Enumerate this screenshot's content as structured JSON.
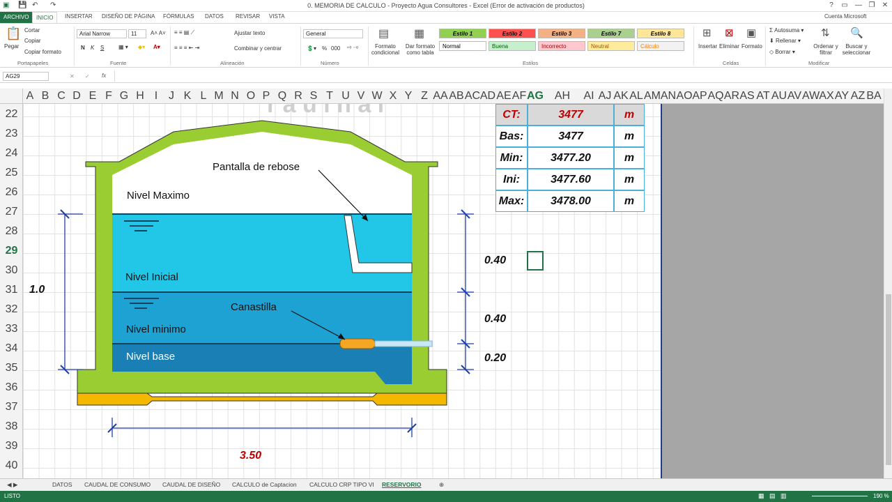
{
  "window": {
    "title": "0. MEMORIA DE CALCULO - Proyecto Agua Consultores - Excel (Error de activación de productos)",
    "account": "Cuenta Microsoft",
    "controls": [
      "?",
      "▭",
      "—",
      "❐",
      "✕"
    ]
  },
  "tabs": [
    "ARCHIVO",
    "INICIO",
    "INSERTAR",
    "DISEÑO DE PÁGINA",
    "FÓRMULAS",
    "DATOS",
    "REVISAR",
    "VISTA"
  ],
  "ribbon": {
    "paste": "Pegar",
    "cut": "Cortar",
    "copy": "Copiar",
    "copy_format": "Copiar formato",
    "group_clipboard": "Portapapeles",
    "font_name": "Arial Narrow",
    "font_size": "11",
    "bold": "N",
    "italic": "K",
    "underline": "S",
    "group_font": "Fuente",
    "wrap_text": "Ajustar texto",
    "merge": "Combinar y centrar",
    "group_align": "Alineación",
    "number_format": "General",
    "percent": "%",
    "thousands": "000",
    "group_number": "Número",
    "cond_format": "Formato condicional",
    "table_format": "Dar formato como tabla",
    "styles": [
      {
        "label": "Estilo 1",
        "bg": "#92d050",
        "color": "#000"
      },
      {
        "label": "Estilo 2",
        "bg": "#ff5050",
        "color": "#000"
      },
      {
        "label": "Estilo 3",
        "bg": "#f4b183",
        "color": "#000"
      },
      {
        "label": "Estilo 7",
        "bg": "#a9d08e",
        "color": "#000"
      },
      {
        "label": "Estilo 8",
        "bg": "#ffe699",
        "color": "#000"
      },
      {
        "label": "Normal",
        "bg": "#ffffff",
        "color": "#000"
      },
      {
        "label": "Buena",
        "bg": "#c6efce",
        "color": "#006100"
      },
      {
        "label": "Incorrecto",
        "bg": "#ffc7ce",
        "color": "#9c0006"
      },
      {
        "label": "Neutral",
        "bg": "#ffeb9c",
        "color": "#9c5700"
      },
      {
        "label": "Cálculo",
        "bg": "#f2f2f2",
        "color": "#fa7d00"
      }
    ],
    "group_styles": "Estilos",
    "insert": "Insertar",
    "delete": "Eliminar",
    "format": "Formato",
    "group_cells": "Celdas",
    "autosum": "Autosuma",
    "fill": "Rellenar",
    "clear": "Borrar",
    "sort": "Ordenar y filtrar",
    "find": "Buscar y seleccionar",
    "group_edit": "Modificar"
  },
  "formula_bar": {
    "name_box": "AG29",
    "fx": "fx",
    "value": ""
  },
  "columns": [
    "A",
    "B",
    "C",
    "D",
    "E",
    "F",
    "G",
    "H",
    "I",
    "J",
    "K",
    "L",
    "M",
    "N",
    "O",
    "P",
    "Q",
    "R",
    "S",
    "T",
    "U",
    "V",
    "W",
    "X",
    "Y",
    "Z",
    "AA",
    "AB",
    "AC",
    "AD",
    "AE",
    "AF",
    "AG",
    "AH",
    "AI",
    "AJ",
    "AK",
    "AL",
    "AM",
    "AN",
    "AO",
    "AP",
    "AQ",
    "AR",
    "AS",
    "AT",
    "AU",
    "AV",
    "AW",
    "AX",
    "AY",
    "AZ",
    "BA"
  ],
  "selected_column": "AG",
  "rows": [
    "22",
    "23",
    "24",
    "25",
    "26",
    "27",
    "28",
    "29",
    "30",
    "31",
    "32",
    "33",
    "34",
    "35",
    "36",
    "37",
    "38",
    "39",
    "40"
  ],
  "selected_row": "29",
  "diagram": {
    "labels": {
      "rebose": "Pantalla de rebose",
      "maximo": "Nivel Maximo",
      "inicial": "Nivel Inicial",
      "canastilla": "Canastilla",
      "minimo": "Nivel minimo",
      "base": "Nivel base"
    },
    "dims": {
      "height": "1.0",
      "d1": "0.40",
      "d2": "0.40",
      "d3": "0.20",
      "width": "3.50"
    },
    "colors": {
      "wall": "#9acd32",
      "water": "#29b6d6",
      "water_dark": "#1a7fb5",
      "base": "#f5b800"
    }
  },
  "levels": [
    {
      "label": "CT:",
      "value": "3477",
      "unit": "m",
      "highlight": true
    },
    {
      "label": "Bas:",
      "value": "3477",
      "unit": "m",
      "highlight": false
    },
    {
      "label": "Min:",
      "value": "3477.20",
      "unit": "m",
      "highlight": false
    },
    {
      "label": "Ini:",
      "value": "3477.60",
      "unit": "m",
      "highlight": false
    },
    {
      "label": "Max:",
      "value": "3478.00",
      "unit": "m",
      "highlight": false
    }
  ],
  "sheet_tabs": [
    "DATOS",
    "CAUDAL DE CONSUMO",
    "CAUDAL DE DISEÑO",
    "CALCULO de Captacion",
    "CALCULO CRP TIPO VI",
    "RESERVORIO"
  ],
  "active_sheet": "RESERVORIO",
  "status": {
    "mode": "LISTO",
    "zoom": "190 %"
  }
}
